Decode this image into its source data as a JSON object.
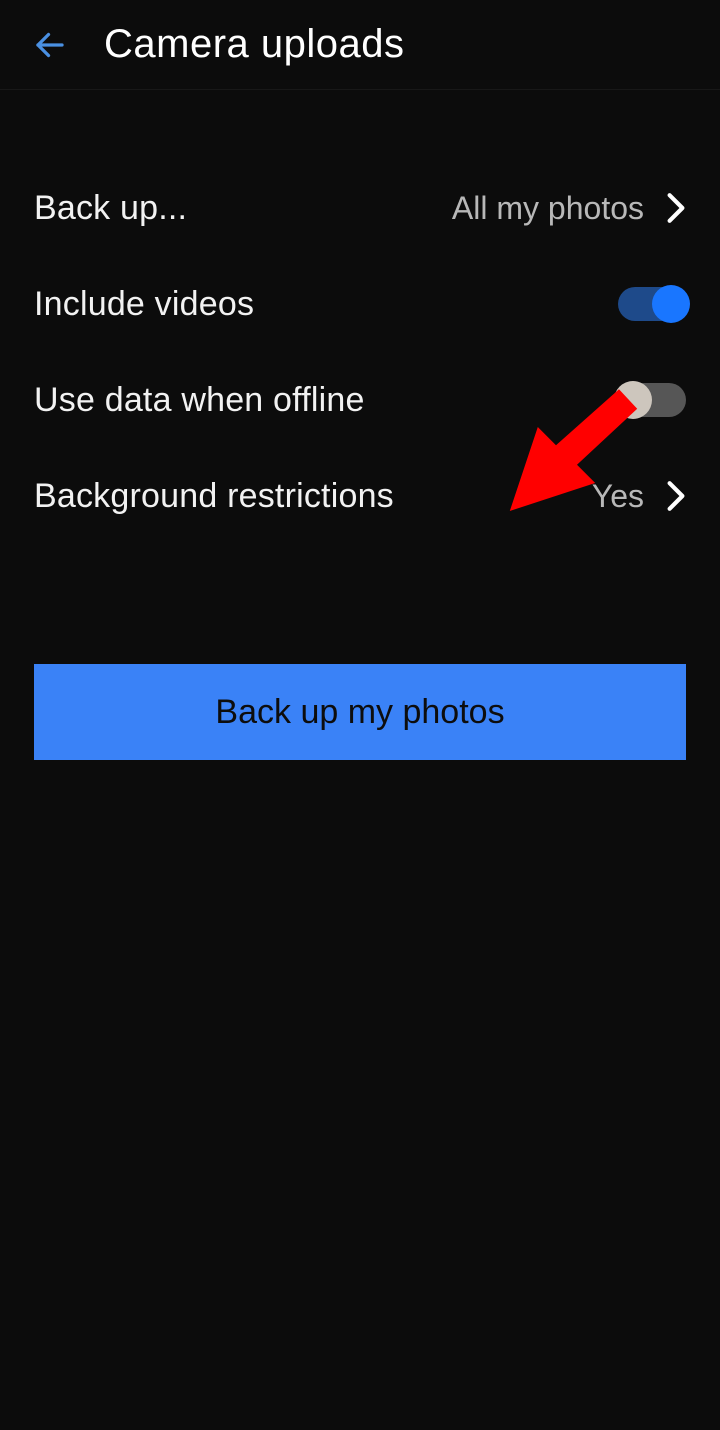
{
  "header": {
    "title": "Camera uploads"
  },
  "rows": {
    "backup": {
      "label": "Back up...",
      "value": "All my photos"
    },
    "videos": {
      "label": "Include videos"
    },
    "data": {
      "label": "Use data when offline"
    },
    "bg": {
      "label": "Background restrictions",
      "value": "Yes"
    }
  },
  "cta": {
    "label": "Back up my photos"
  },
  "toggles": {
    "videos": true,
    "data": false
  },
  "colors": {
    "accent": "#3a82f7",
    "toggle_on": "#1976ff",
    "annotation": "#ff0000"
  }
}
